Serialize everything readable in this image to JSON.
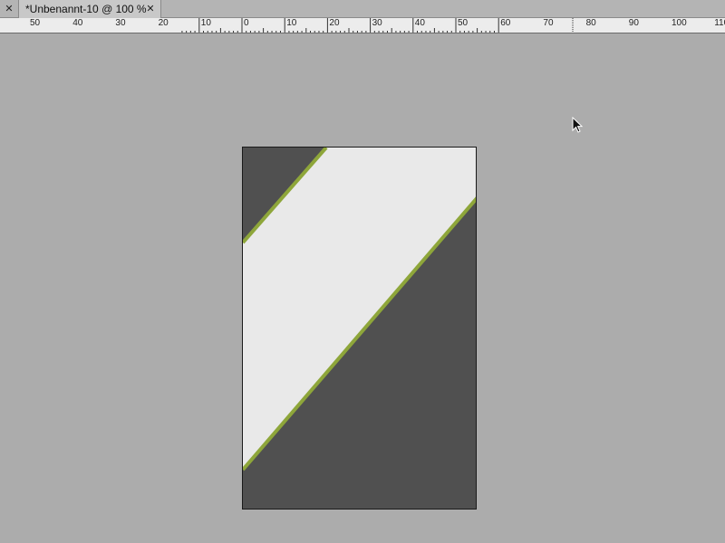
{
  "tabs": {
    "close_left_icon": "close-icon",
    "active": {
      "title": "*Unbenannt-10 @ 100 %",
      "close_icon": "close-icon"
    }
  },
  "ruler": {
    "labels": [
      "50",
      "40",
      "30",
      "20",
      "10",
      "0",
      "10",
      "20",
      "30",
      "40",
      "50",
      "60",
      "70",
      "80",
      "90",
      "100",
      "110"
    ]
  },
  "document": {
    "colors": {
      "pasteboard": "#acacac",
      "dark": "#505050",
      "light": "#e9e9e9",
      "accent": "#8ea63a"
    }
  },
  "cursor": {
    "icon": "arrow-cursor-icon"
  }
}
